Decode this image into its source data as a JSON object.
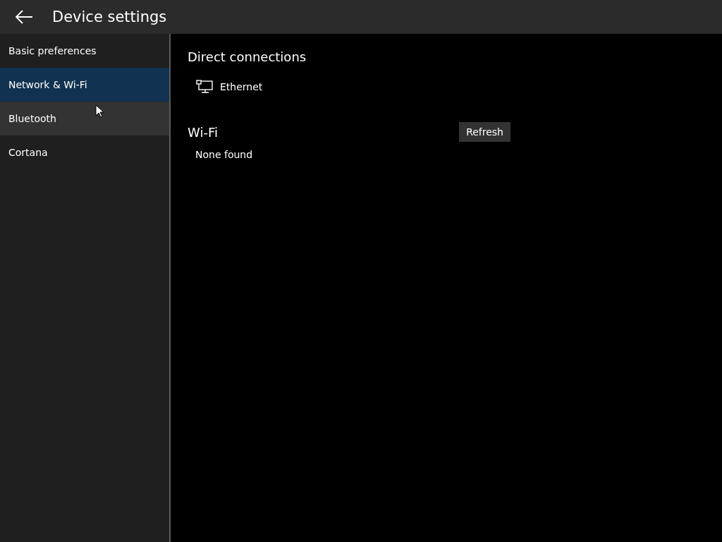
{
  "window": {
    "title": "Device settings"
  },
  "sidebar": {
    "items": [
      {
        "label": "Basic preferences",
        "selected": false,
        "hovered": false
      },
      {
        "label": "Network & Wi-Fi",
        "selected": true,
        "hovered": false
      },
      {
        "label": "Bluetooth",
        "selected": false,
        "hovered": true
      },
      {
        "label": "Cortana",
        "selected": false,
        "hovered": false
      }
    ]
  },
  "direct_connections": {
    "heading": "Direct connections",
    "items": [
      {
        "label": "Ethernet"
      }
    ]
  },
  "wifi": {
    "heading": "Wi-Fi",
    "refresh_button": "Refresh",
    "status": "None found"
  }
}
